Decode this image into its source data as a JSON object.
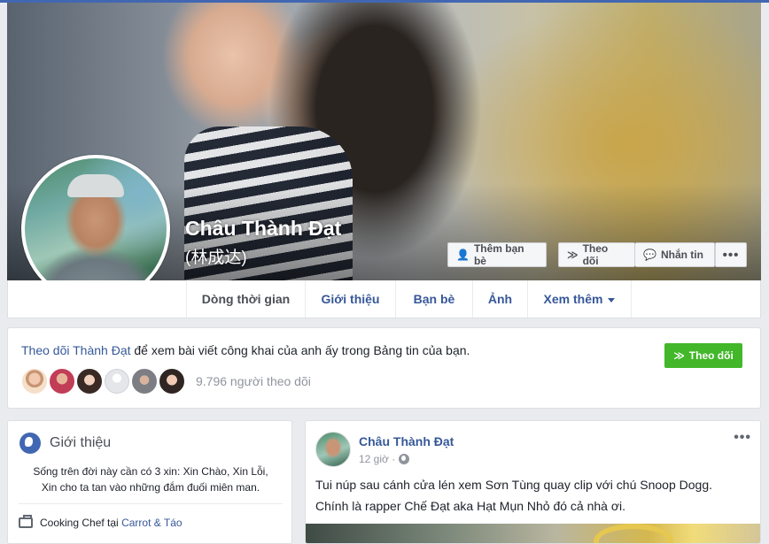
{
  "profile": {
    "name": "Châu Thành Đạt",
    "alt_name": "(林成达)"
  },
  "cover_actions": {
    "add_friend": "Thêm bạn bè",
    "follow": "Theo dõi",
    "message": "Nhắn tin",
    "more": "•••"
  },
  "nav": {
    "tabs": [
      {
        "label": "Dòng thời gian"
      },
      {
        "label": "Giới thiệu"
      },
      {
        "label": "Bạn bè"
      },
      {
        "label": "Ảnh"
      },
      {
        "label": "Xem thêm"
      }
    ]
  },
  "follow_box": {
    "link": "Theo dõi Thành Đạt",
    "text": " để xem bài viết công khai của anh ấy trong Bảng tin của bạn.",
    "button": "Theo dõi",
    "followers": "9.796 người theo dõi"
  },
  "intro": {
    "title": "Giới thiệu",
    "bio_line1": "Sống trên đời này cần có 3 xin: Xin Chào, Xin Lỗi,",
    "bio_line2": "Xin cho ta tan vào những đắm đuối miên man.",
    "work_prefix": "Cooking Chef tại ",
    "work_place": "Carrot & Táo"
  },
  "post": {
    "author": "Châu Thành Đạt",
    "time": "12 giờ · ",
    "more": "•••",
    "line1": "Tui núp sau cánh cửa lén xem Sơn Tùng quay clip với chú Snoop Dogg.",
    "line2": "Chính là rapper Chế Đạt aka Hạt Mụn Nhỏ đó cả nhà ơi."
  },
  "colors": {
    "brand": "#4267b2",
    "link": "#365899",
    "follow_green": "#42b72a"
  }
}
